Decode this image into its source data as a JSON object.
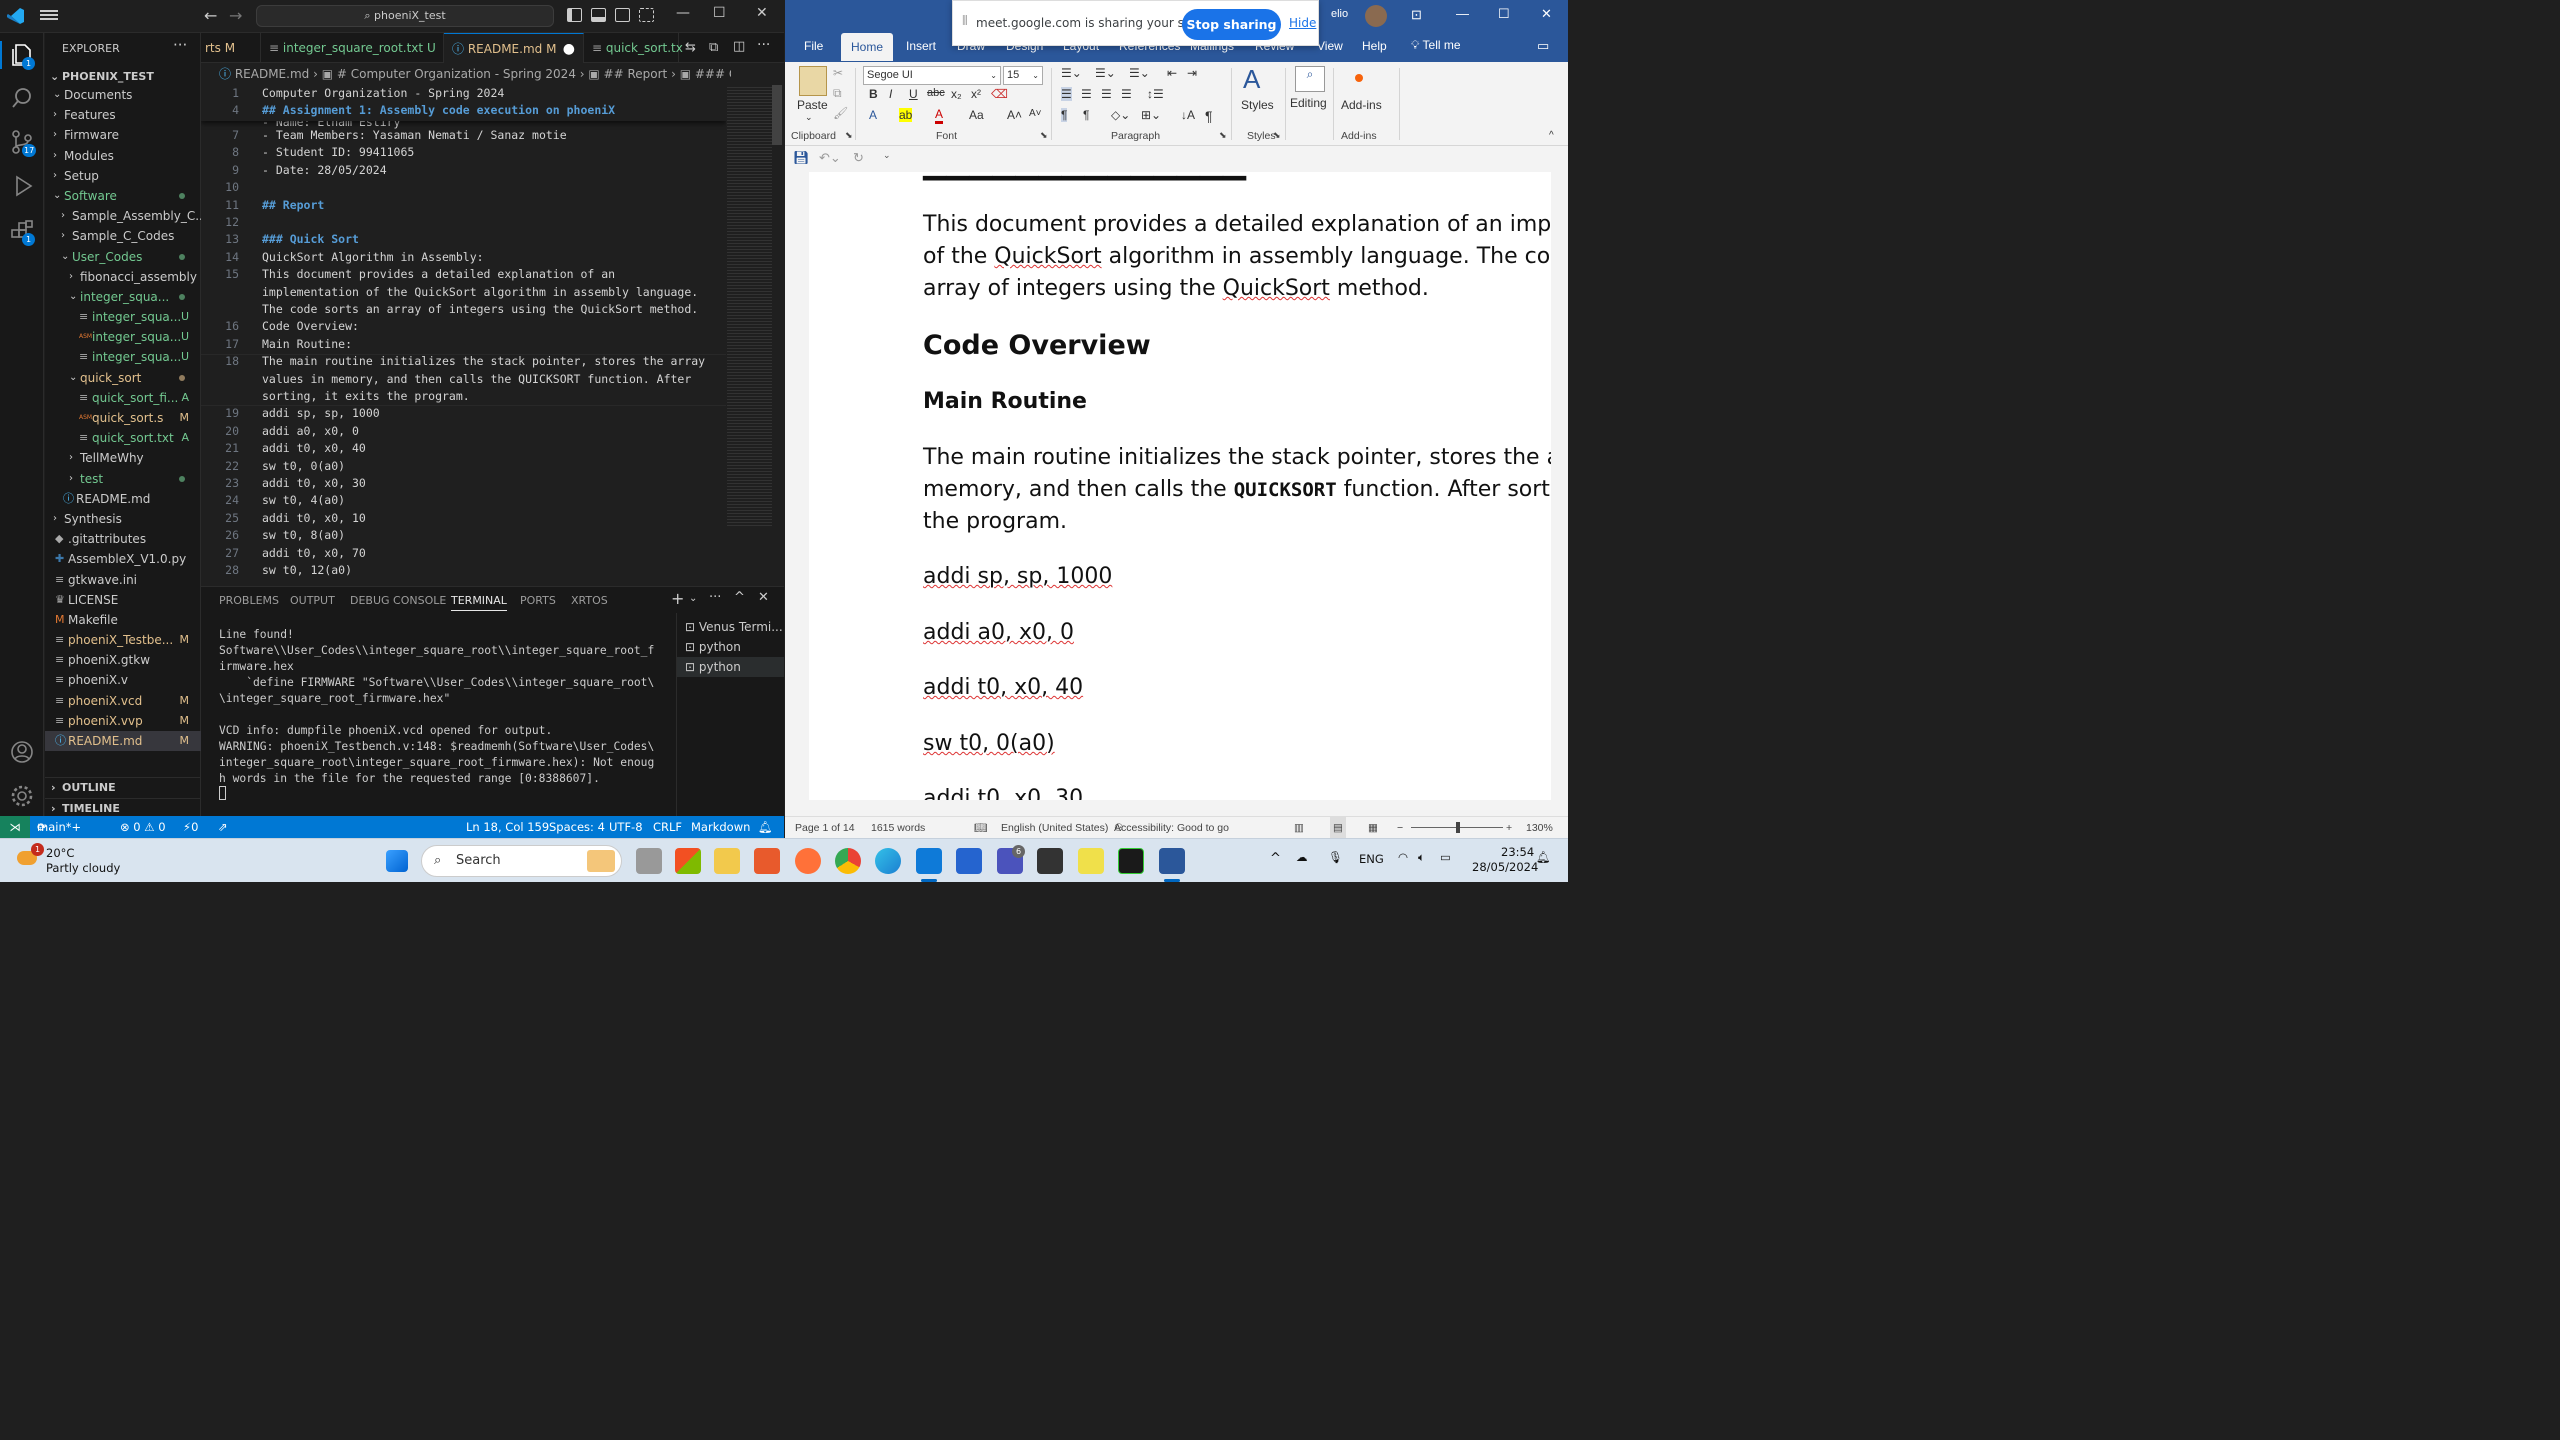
{
  "vscode": {
    "window_title": "phoeniX_test",
    "explorer_title": "EXPLORER",
    "project_name": "PHOENIX_TEST",
    "tree": [
      {
        "label": "Documents",
        "indent": 1,
        "chev": "v",
        "status": "",
        "color": "#cccccc"
      },
      {
        "label": "Features",
        "indent": 1,
        "chev": ">",
        "status": "",
        "color": "#cccccc"
      },
      {
        "label": "Firmware",
        "indent": 1,
        "chev": ">",
        "status": "",
        "color": "#cccccc"
      },
      {
        "label": "Modules",
        "indent": 1,
        "chev": ">",
        "status": "",
        "color": "#cccccc"
      },
      {
        "label": "Setup",
        "indent": 1,
        "chev": ">",
        "status": "",
        "color": "#cccccc"
      },
      {
        "label": "Software",
        "indent": 1,
        "chev": "v",
        "status": "dot",
        "color": "#73c991"
      },
      {
        "label": "Sample_Assembly_C...",
        "indent": 2,
        "chev": ">",
        "status": "",
        "color": "#cccccc"
      },
      {
        "label": "Sample_C_Codes",
        "indent": 2,
        "chev": ">",
        "status": "",
        "color": "#cccccc"
      },
      {
        "label": "User_Codes",
        "indent": 2,
        "chev": "v",
        "status": "dot",
        "color": "#73c991"
      },
      {
        "label": "fibonacci_assembly",
        "indent": 3,
        "chev": ">",
        "status": "",
        "color": "#cccccc"
      },
      {
        "label": "integer_squa...",
        "indent": 3,
        "chev": "v",
        "status": "dot",
        "color": "#73c991"
      },
      {
        "label": "integer_squa...",
        "indent": 4,
        "chev": "",
        "status": "U",
        "color": "#73c991",
        "icon": "≡"
      },
      {
        "label": "integer_squa...",
        "indent": 4,
        "chev": "",
        "status": "U",
        "color": "#73c991",
        "icon": "ASM"
      },
      {
        "label": "integer_squa...",
        "indent": 4,
        "chev": "",
        "status": "U",
        "color": "#73c991",
        "icon": "≡"
      },
      {
        "label": "quick_sort",
        "indent": 3,
        "chev": "v",
        "status": "dot",
        "color": "#e2c08d"
      },
      {
        "label": "quick_sort_fi...",
        "indent": 4,
        "chev": "",
        "status": "A",
        "color": "#73c991",
        "icon": "≡"
      },
      {
        "label": "quick_sort.s",
        "indent": 4,
        "chev": "",
        "status": "M",
        "color": "#e2c08d",
        "icon": "ASM"
      },
      {
        "label": "quick_sort.txt",
        "indent": 4,
        "chev": "",
        "status": "A",
        "color": "#73c991",
        "icon": "≡"
      },
      {
        "label": "TellMeWhy",
        "indent": 3,
        "chev": ">",
        "status": "",
        "color": "#cccccc"
      },
      {
        "label": "test",
        "indent": 3,
        "chev": ">",
        "status": "dot",
        "color": "#73c991"
      },
      {
        "label": "README.md",
        "indent": 2,
        "chev": "",
        "status": "",
        "color": "#cccccc",
        "icon": "ⓘ"
      },
      {
        "label": "Synthesis",
        "indent": 1,
        "chev": ">",
        "status": "",
        "color": "#cccccc"
      },
      {
        "label": ".gitattributes",
        "indent": 1,
        "chev": "",
        "status": "",
        "color": "#cccccc",
        "icon": "◆"
      },
      {
        "label": "AssembleX_V1.0.py",
        "indent": 1,
        "chev": "",
        "status": "",
        "color": "#cccccc",
        "icon": "✚"
      },
      {
        "label": "gtkwave.ini",
        "indent": 1,
        "chev": "",
        "status": "",
        "color": "#cccccc",
        "icon": "≡"
      },
      {
        "label": "LICENSE",
        "indent": 1,
        "chev": "",
        "status": "",
        "color": "#cccccc",
        "icon": "♛"
      },
      {
        "label": "Makefile",
        "indent": 1,
        "chev": "",
        "status": "",
        "color": "#cccccc",
        "icon": "M"
      },
      {
        "label": "phoeniX_Testbe...",
        "indent": 1,
        "chev": "",
        "status": "M",
        "color": "#e2c08d",
        "icon": "≡"
      },
      {
        "label": "phoeniX.gtkw",
        "indent": 1,
        "chev": "",
        "status": "",
        "color": "#cccccc",
        "icon": "≡"
      },
      {
        "label": "phoeniX.v",
        "indent": 1,
        "chev": "",
        "status": "",
        "color": "#cccccc",
        "icon": "≡"
      },
      {
        "label": "phoeniX.vcd",
        "indent": 1,
        "chev": "",
        "status": "M",
        "color": "#e2c08d",
        "icon": "≡"
      },
      {
        "label": "phoeniX.vvp",
        "indent": 1,
        "chev": "",
        "status": "M",
        "color": "#e2c08d",
        "icon": "≡"
      },
      {
        "label": "README.md",
        "indent": 1,
        "chev": "",
        "status": "M",
        "color": "#e2c08d",
        "icon": "ⓘ",
        "selected": true
      }
    ],
    "outline_label": "OUTLINE",
    "timeline_label": "TIMELINE",
    "tabs": [
      {
        "label": "rts",
        "status": "M"
      },
      {
        "label": "integer_square_root.txt",
        "status": "U"
      },
      {
        "label": "README.md",
        "status": "M",
        "active": true
      },
      {
        "label": "quick_sort.tx",
        "status": ""
      }
    ],
    "breadcrumb": [
      "README.md",
      "# Computer Organization - Spring 2024",
      "## Report",
      "### Quick Sort"
    ],
    "sticky": [
      {
        "n": "1",
        "text": "Computer Organization - Spring 2024",
        "h": false
      },
      {
        "n": "4",
        "text": "## Assignment 1: Assembly code execution on phoeniX",
        "h": true
      }
    ],
    "lines": [
      {
        "n": "7",
        "text": "- Team Members: Yasaman Nemati / Sanaz motie",
        "h": false
      },
      {
        "n": "8",
        "text": "- Student ID: 99411065",
        "h": false
      },
      {
        "n": "9",
        "text": "- Date: 28/05/2024",
        "h": false
      },
      {
        "n": "10",
        "text": "",
        "h": false
      },
      {
        "n": "11",
        "text": "## Report",
        "h": true
      },
      {
        "n": "12",
        "text": "",
        "h": false
      },
      {
        "n": "13",
        "text": "### Quick Sort",
        "h": true
      },
      {
        "n": "14",
        "text": "QuickSort Algorithm in Assembly:",
        "h": false
      },
      {
        "n": "15",
        "text": "This document provides a detailed explanation of an",
        "h": false
      },
      {
        "n": "",
        "text": "implementation of the QuickSort algorithm in assembly language.",
        "h": false
      },
      {
        "n": "",
        "text": "The code sorts an array of integers using the QuickSort method.",
        "h": false
      },
      {
        "n": "16",
        "text": "Code Overview:",
        "h": false
      },
      {
        "n": "17",
        "text": "Main Routine:",
        "h": false
      },
      {
        "n": "18",
        "text": "The main routine initializes the stack pointer, stores the array",
        "h": false
      },
      {
        "n": "",
        "text": "values in memory, and then calls the QUICKSORT function. After",
        "h": false
      },
      {
        "n": "",
        "text": "sorting, it exits the program.",
        "h": false
      },
      {
        "n": "19",
        "text": "addi sp, sp, 1000",
        "h": false
      },
      {
        "n": "20",
        "text": "addi a0, x0, 0",
        "h": false
      },
      {
        "n": "21",
        "text": "addi t0, x0, 40",
        "h": false
      },
      {
        "n": "22",
        "text": "sw t0, 0(a0)",
        "h": false
      },
      {
        "n": "23",
        "text": "addi t0, x0, 30",
        "h": false
      },
      {
        "n": "24",
        "text": "sw t0, 4(a0)",
        "h": false
      },
      {
        "n": "25",
        "text": "addi t0, x0, 10",
        "h": false
      },
      {
        "n": "26",
        "text": "sw t0, 8(a0)",
        "h": false
      },
      {
        "n": "27",
        "text": "addi t0, x0, 70",
        "h": false
      },
      {
        "n": "28",
        "text": "sw t0, 12(a0)",
        "h": false
      }
    ],
    "panel_tabs": [
      "PROBLEMS",
      "OUTPUT",
      "DEBUG CONSOLE",
      "TERMINAL",
      "PORTS",
      "XRTOS"
    ],
    "terminal_text": "Line found!\nSoftware\\\\User_Codes\\\\integer_square_root\\\\integer_square_root_f\nirmware.hex\n    `define FIRMWARE \"Software\\\\User_Codes\\\\integer_square_root\\\n\\integer_square_root_firmware.hex\"\n\nVCD info: dumpfile phoeniX.vcd opened for output.\nWARNING: phoeniX_Testbench.v:148: $readmemh(Software\\User_Codes\\\ninteger_square_root\\integer_square_root_firmware.hex): Not enoug\nh words in the file for the requested range [0:8388607].",
    "terminals": [
      "Venus Termi...",
      "python",
      "python"
    ],
    "status": {
      "branch": "main*+",
      "problems": "⊗ 0 ⚠ 0",
      "ports": "⚡0",
      "position": "Ln 18, Col 159",
      "spaces": "Spaces: 4",
      "encoding": "UTF-8",
      "eol": "CRLF",
      "language": "Markdown"
    }
  },
  "word": {
    "meet_text": "meet.google.com is sharing your screen.",
    "stop_sharing": "Stop sharing",
    "hide": "Hide",
    "user": "elio",
    "tabs": [
      "File",
      "Home",
      "Insert",
      "Draw",
      "Design",
      "Layout",
      "References",
      "Mailings",
      "Review",
      "View",
      "Help"
    ],
    "tell_me": "Tell me",
    "ribbon": {
      "paste": "Paste",
      "clipboard": "Clipboard",
      "font_name": "Segoe UI",
      "font_size": "15",
      "font": "Font",
      "paragraph": "Paragraph",
      "styles": "Styles",
      "styles_group": "Styles",
      "editing": "Editing",
      "addins": "Add-ins",
      "addins_group": "Add-ins"
    },
    "doc": {
      "intro1": "This document provides a detailed explanation of an implen",
      "intro2a": "of the ",
      "intro2b": "QuickSort",
      "intro2c": " algorithm in assembly language. The code",
      "intro3a": "array of integers using the ",
      "intro3b": "QuickSort",
      "intro3c": " method.",
      "h_overview": "Code Overview",
      "h_main": "Main Routine",
      "main1": "The main routine initializes the stack pointer, stores the arra",
      "main2a": "memory, and then calls the ",
      "main2b": "QUICKSORT",
      "main2c": " function. After sorting",
      "main3": "the program.",
      "code": [
        "addi sp, sp, 1000",
        "addi a0, x0, 0",
        "addi t0, x0, 40",
        "sw t0, 0(a0)",
        "addi t0, x0, 30"
      ]
    },
    "status": {
      "page": "Page 1 of 14",
      "words": "1615 words",
      "lang": "English (United States)",
      "access": "Accessibility: Good to go",
      "zoom": "130%"
    }
  },
  "taskbar": {
    "temp": "20°C",
    "weather": "Partly cloudy",
    "weather_badge": "1",
    "search": "Search",
    "lang": "ENG",
    "time": "23:54",
    "date": "28/05/2024",
    "teams_badge": "6"
  }
}
